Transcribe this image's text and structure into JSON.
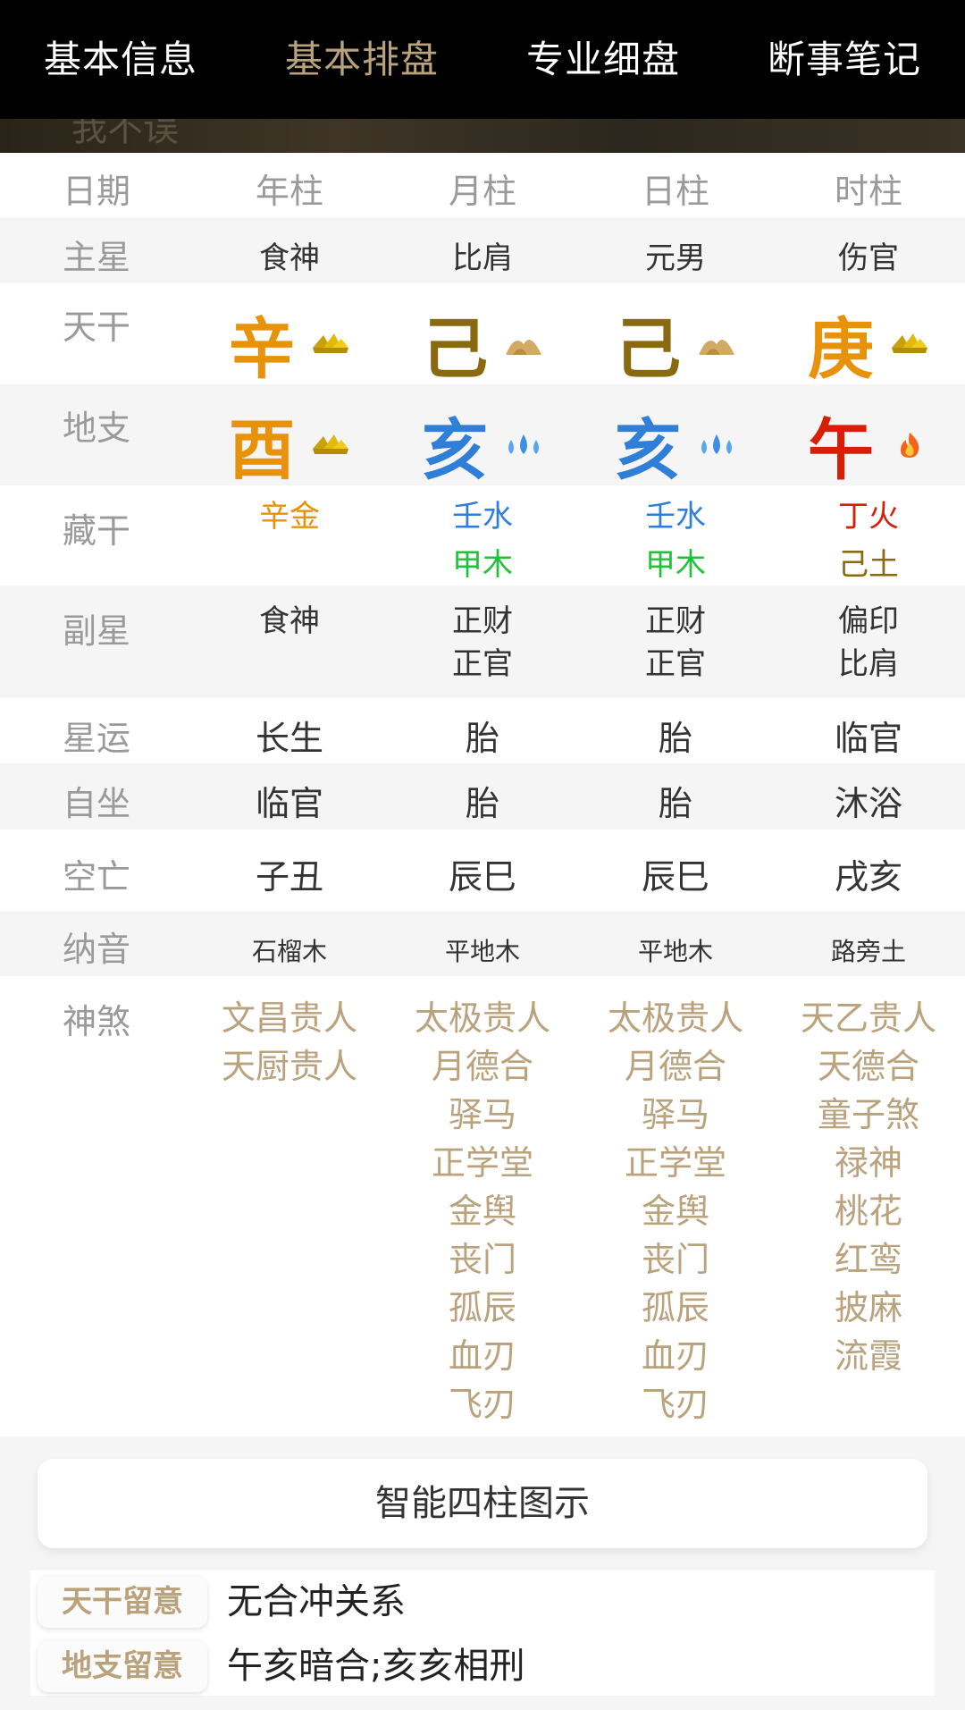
{
  "nav": {
    "tabs": [
      "基本信息",
      "基本排盘",
      "专业细盘",
      "断事笔记"
    ],
    "active_index": 1
  },
  "banner": {
    "text": "我不误"
  },
  "header_row": {
    "label": "日期",
    "cols": [
      "年柱",
      "月柱",
      "日柱",
      "时柱"
    ]
  },
  "main_star": {
    "label": "主星",
    "cols": [
      "食神",
      "比肩",
      "元男",
      "伤官"
    ]
  },
  "tiangan": {
    "label": "天干",
    "cols": [
      {
        "char": "辛",
        "color": "#e8920a",
        "icon": "metal-icon"
      },
      {
        "char": "己",
        "color": "#8a6a10",
        "icon": "earth-icon"
      },
      {
        "char": "己",
        "color": "#8a6a10",
        "icon": "earth-icon"
      },
      {
        "char": "庚",
        "color": "#e8920a",
        "icon": "metal-icon"
      }
    ]
  },
  "dizhi": {
    "label": "地支",
    "cols": [
      {
        "char": "酉",
        "color": "#e8920a",
        "icon": "metal-icon"
      },
      {
        "char": "亥",
        "color": "#2f7fd8",
        "icon": "water-icon"
      },
      {
        "char": "亥",
        "color": "#2f7fd8",
        "icon": "water-icon"
      },
      {
        "char": "午",
        "color": "#d81e06",
        "icon": "fire-icon"
      }
    ]
  },
  "canggan": {
    "label": "藏干",
    "cols": [
      [
        {
          "text": "辛金",
          "color": "#e8920a"
        }
      ],
      [
        {
          "text": "壬水",
          "color": "#2f7fd8"
        },
        {
          "text": "甲木",
          "color": "#22c13a"
        }
      ],
      [
        {
          "text": "壬水",
          "color": "#2f7fd8"
        },
        {
          "text": "甲木",
          "color": "#22c13a"
        }
      ],
      [
        {
          "text": "丁火",
          "color": "#d81e06"
        },
        {
          "text": "己土",
          "color": "#8a6a10"
        }
      ]
    ]
  },
  "fuxing": {
    "label": "副星",
    "cols": [
      [
        "食神"
      ],
      [
        "正财",
        "正官"
      ],
      [
        "正财",
        "正官"
      ],
      [
        "偏印",
        "比肩"
      ]
    ]
  },
  "xingyun": {
    "label": "星运",
    "cols": [
      "长生",
      "胎",
      "胎",
      "临官"
    ]
  },
  "zizuo": {
    "label": "自坐",
    "cols": [
      "临官",
      "胎",
      "胎",
      "沐浴"
    ]
  },
  "kongwang": {
    "label": "空亡",
    "cols": [
      "子丑",
      "辰巳",
      "辰巳",
      "戌亥"
    ]
  },
  "nayin": {
    "label": "纳音",
    "cols": [
      "石榴木",
      "平地木",
      "平地木",
      "路旁土"
    ]
  },
  "shensha": {
    "label": "神煞",
    "color": "#b9a27c",
    "cols": [
      [
        "文昌贵人",
        "天厨贵人"
      ],
      [
        "太极贵人",
        "月德合",
        "驿马",
        "正学堂",
        "金舆",
        "丧门",
        "孤辰",
        "血刃",
        "飞刃"
      ],
      [
        "太极贵人",
        "月德合",
        "驿马",
        "正学堂",
        "金舆",
        "丧门",
        "孤辰",
        "血刃",
        "飞刃"
      ],
      [
        "天乙贵人",
        "天德合",
        "童子煞",
        "禄神",
        "桃花",
        "红鸾",
        "披麻",
        "流霞"
      ]
    ]
  },
  "smart_button": {
    "label": "智能四柱图示"
  },
  "notes": [
    {
      "tag": "天干留意",
      "text": "无合冲关系"
    },
    {
      "tag": "地支留意",
      "text": "午亥暗合;亥亥相刑"
    }
  ]
}
